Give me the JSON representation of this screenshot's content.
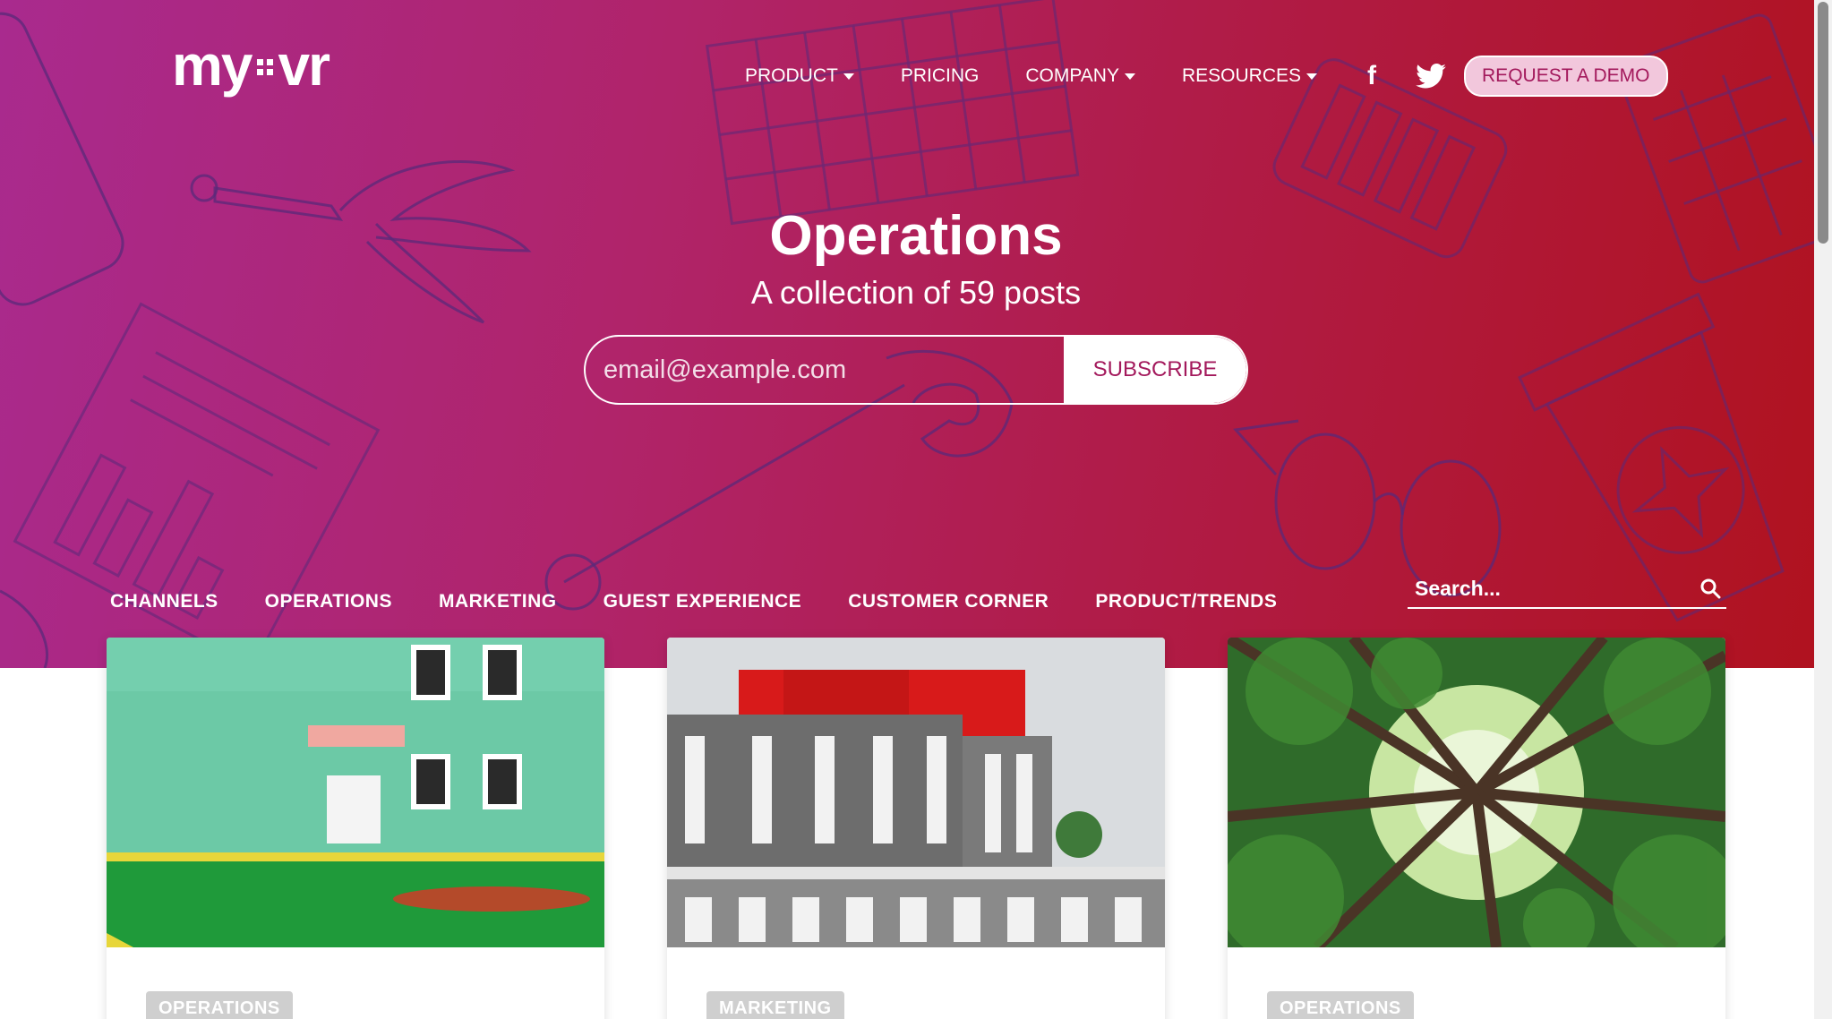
{
  "brand": {
    "logo_left": "my",
    "logo_right": "vr"
  },
  "nav": {
    "items": [
      {
        "label": "PRODUCT",
        "dropdown": true
      },
      {
        "label": "PRICING",
        "dropdown": false
      },
      {
        "label": "COMPANY",
        "dropdown": true
      },
      {
        "label": "RESOURCES",
        "dropdown": true
      }
    ],
    "social": [
      "facebook-icon",
      "twitter-icon"
    ],
    "cta": "REQUEST A DEMO"
  },
  "hero": {
    "title": "Operations",
    "subtitle": "A collection of 59 posts",
    "email_placeholder": "email@example.com",
    "subscribe_label": "SUBSCRIBE"
  },
  "categories": [
    "CHANNELS",
    "OPERATIONS",
    "MARKETING",
    "GUEST EXPERIENCE",
    "CUSTOMER CORNER",
    "PRODUCT/TRENDS"
  ],
  "search": {
    "placeholder": "Search..."
  },
  "posts": [
    {
      "tag": "OPERATIONS",
      "image": "green-building-photo"
    },
    {
      "tag": "MARKETING",
      "image": "red-grey-building-photo"
    },
    {
      "tag": "OPERATIONS",
      "image": "forest-canopy-photo"
    }
  ],
  "colors": {
    "accent": "#a3195c",
    "gradient_start": "#a92a8e",
    "gradient_end": "#b0121e",
    "line_art": "#5a2a7a"
  }
}
